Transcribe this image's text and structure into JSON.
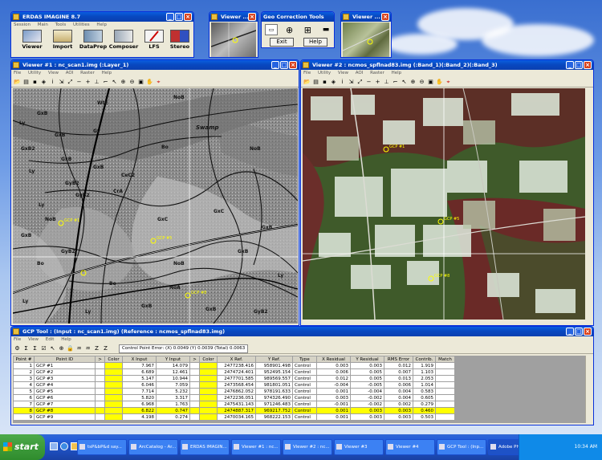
{
  "erdas_main": {
    "title": "ERDAS IMAGINE 8.7",
    "menu": [
      "Session",
      "Main",
      "Tools",
      "Utilities",
      "Help"
    ],
    "buttons": [
      "Viewer",
      "Import",
      "DataPrep",
      "Composer",
      "LFS",
      "Stereo"
    ]
  },
  "viewer3": {
    "title": "Viewer ..."
  },
  "geo_tools": {
    "title": "Geo Correction Tools",
    "exit": "Exit",
    "help": "Help"
  },
  "viewer4": {
    "title": "Viewer ..."
  },
  "viewer1": {
    "title": "Viewer #1 : nc_scan1.img (:Layer_1)",
    "menu": [
      "File",
      "Utility",
      "View",
      "AOI",
      "Raster",
      "Help"
    ],
    "soil_labels": [
      "WtE",
      "GxB",
      "NoB",
      "Ly",
      "Swamp",
      "GxB",
      "Gy",
      "GxB2",
      "Bo",
      "NoB",
      "GxB",
      "Ly",
      "GxB",
      "CeC2",
      "CrA",
      "GyB2",
      "Ly",
      "NoB",
      "GxB",
      "GxC",
      "GxB",
      "GyB2",
      "Bo",
      "NoB",
      "GxC",
      "GxB",
      "Ly",
      "Bo",
      "GxB",
      "Ly",
      "GxB",
      "NoA",
      "Ly",
      "GyB2",
      "GyB2"
    ]
  },
  "viewer2": {
    "title": "Viewer #2 : ncmos_spflnad83.img (:Band_1)(:Band_2)(:Band_3)",
    "menu": [
      "File",
      "Utility",
      "View",
      "AOI",
      "Raster",
      "Help"
    ]
  },
  "gcp_tool": {
    "title": "GCP Tool : (Input : nc_scan1.img) (Reference : ncmos_spflnad83.img)",
    "menu": [
      "File",
      "View",
      "Edit",
      "Help"
    ],
    "status": "Control Point Error: (X) 0.0049  (Y) 0.0039  (Total) 0.0063",
    "columns": [
      "Point #",
      "Point ID",
      ">",
      "Color",
      "X Input",
      "Y Input",
      ">",
      "Color",
      "X Ref.",
      "Y Ref.",
      "Type",
      "X Residual",
      "Y Residual",
      "RMS Error",
      "Contrib.",
      "Match"
    ],
    "rows": [
      [
        "1",
        "GCP #1",
        "",
        "",
        "7.967",
        "14.079",
        "",
        "",
        "2477238.416",
        "958901.498",
        "Control",
        "0.003",
        "0.003",
        "0.012",
        "1.919",
        ""
      ],
      [
        "2",
        "GCP #2",
        "",
        "",
        "6.689",
        "12.461",
        "",
        "",
        "2474724.401",
        "952495.154",
        "Control",
        "0.006",
        "0.005",
        "0.007",
        "1.103",
        ""
      ],
      [
        "3",
        "GCP #3",
        "",
        "",
        "5.147",
        "10.944",
        "",
        "",
        "2477701.585",
        "989569.557",
        "Control",
        "0.012",
        "0.005",
        "0.013",
        "2.053",
        ""
      ],
      [
        "4",
        "GCP #4",
        "",
        "",
        "6.046",
        "7.059",
        "",
        "",
        "2473568.454",
        "981801.051",
        "Control",
        "-0.004",
        "-0.005",
        "0.006",
        "1.014",
        ""
      ],
      [
        "5",
        "GCP #5",
        "",
        "",
        "7.714",
        "5.232",
        "",
        "",
        "2476862.052",
        "978191.633",
        "Control",
        "0.001",
        "-0.004",
        "0.004",
        "0.583",
        ""
      ],
      [
        "6",
        "GCP #6",
        "",
        "",
        "5.820",
        "3.317",
        "",
        "",
        "2472236.051",
        "974326.490",
        "Control",
        "0.003",
        "-0.002",
        "0.004",
        "0.605",
        ""
      ],
      [
        "7",
        "GCP #7",
        "",
        "",
        "6.968",
        "1.763",
        "",
        "",
        "2475431.143",
        "971246.483",
        "Control",
        "-0.001",
        "-0.002",
        "0.002",
        "0.279",
        ""
      ],
      [
        "8",
        "GCP #8",
        "",
        "",
        "6.822",
        "0.747",
        "",
        "",
        "2474887.317",
        "969217.752",
        "Control",
        "0.001",
        "0.003",
        "0.003",
        "0.460",
        ""
      ],
      [
        "9",
        "GCP #9",
        "",
        "",
        "4.198",
        "0.274",
        "",
        "",
        "2470034.165",
        "968222.153",
        "Control",
        "0.001",
        "0.003",
        "0.003",
        "0.503",
        ""
      ]
    ]
  },
  "taskbar": {
    "start": "start",
    "items": [
      "tsP&bP&d say...",
      "ArcCatalog - Ar...",
      "ERDAS IMAGIN...",
      "Viewer #1 : nc...",
      "Viewer #2 : nc...",
      "Viewer #3",
      "Viewer #4",
      "GCP Tool : (Inp...",
      "Adobe Photoshop"
    ],
    "clock": "10:34 AM"
  },
  "colors": {
    "accent": "#0a5ee0",
    "gcp_yellow": "#ffff00",
    "selected_row": "#ffff00"
  }
}
